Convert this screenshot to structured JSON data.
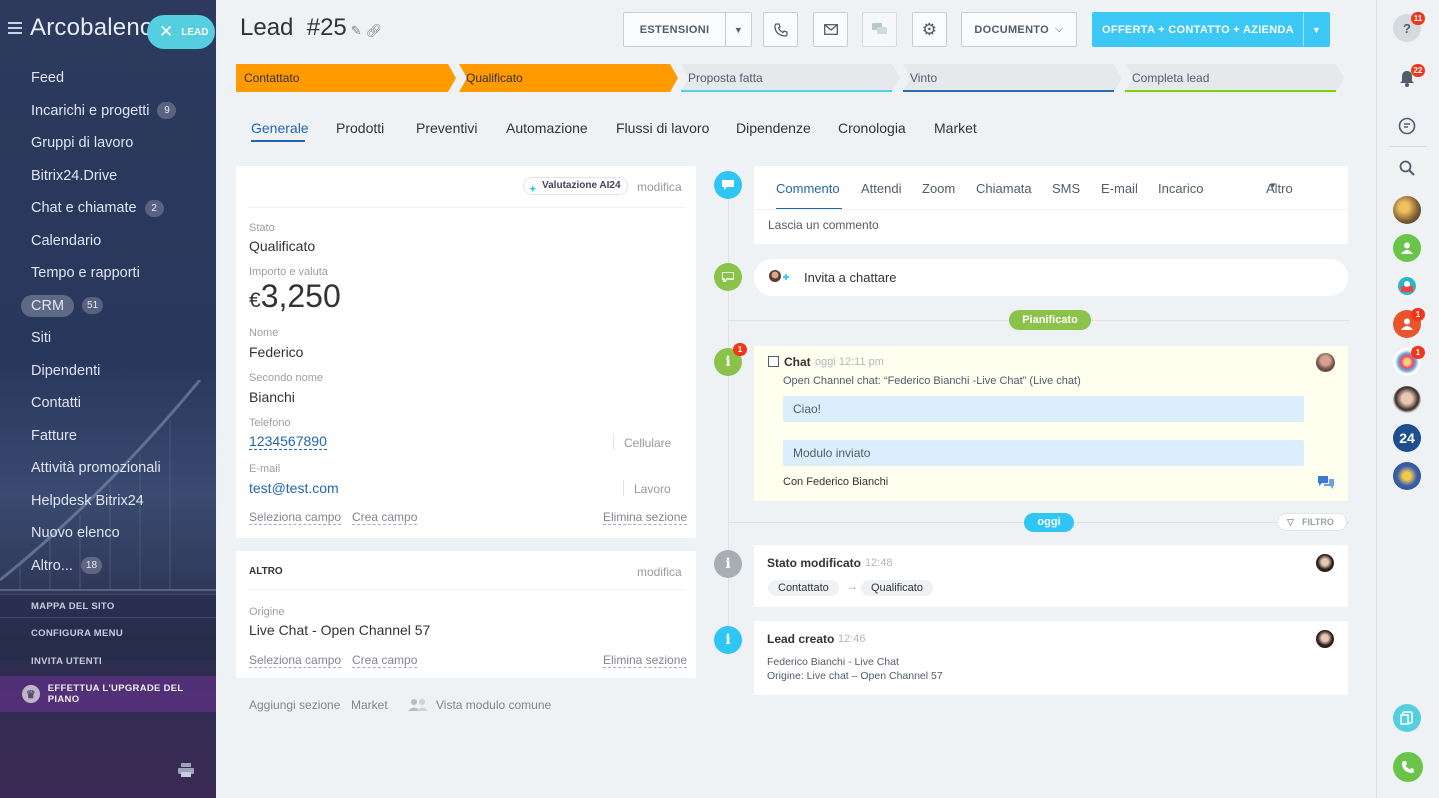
{
  "sidebar": {
    "brand": "Arcobaleno",
    "lead_pill": "LEAD",
    "items": [
      {
        "label": "Feed",
        "count": ""
      },
      {
        "label": "Incarichi e progetti",
        "count": "9"
      },
      {
        "label": "Gruppi di lavoro",
        "count": ""
      },
      {
        "label": "Bitrix24.Drive",
        "count": ""
      },
      {
        "label": "Chat e chiamate",
        "count": "2"
      },
      {
        "label": "Calendario",
        "count": ""
      },
      {
        "label": "Tempo e rapporti",
        "count": ""
      },
      {
        "label": "CRM",
        "count": "51"
      },
      {
        "label": "Siti",
        "count": ""
      },
      {
        "label": "Dipendenti",
        "count": ""
      },
      {
        "label": "Contatti",
        "count": ""
      },
      {
        "label": "Fatture",
        "count": ""
      },
      {
        "label": "Attività promozionali",
        "count": ""
      },
      {
        "label": "Helpdesk Bitrix24",
        "count": ""
      },
      {
        "label": "Nuovo elenco",
        "count": ""
      },
      {
        "label": "Altro...",
        "count": "18"
      }
    ],
    "site_map": "MAPPA DEL SITO",
    "configure_menu": "CONFIGURA MENU",
    "invite_users": "INVITA UTENTI",
    "upgrade": "EFFETTUA L'UPGRADE DEL PIANO"
  },
  "header": {
    "title": "Lead  #25",
    "extensions": "ESTENSIONI",
    "document": "DOCUMENTO",
    "primary": "OFFERTA + CONTATTO + AZIENDA"
  },
  "stages": [
    {
      "label": "Contattato",
      "color": "#ff9a00"
    },
    {
      "label": "Qualificato",
      "color": "#ff9a00"
    },
    {
      "label": "Proposta fatta",
      "color": "#e6e9ec"
    },
    {
      "label": "Vinto",
      "color": "#e6e9ec"
    },
    {
      "label": "Completa lead",
      "color": "#e6e9ec"
    }
  ],
  "tabs": [
    "Generale",
    "Prodotti",
    "Preventivi",
    "Automazione",
    "Flussi di lavoro",
    "Dipendenze",
    "Cronologia",
    "Market"
  ],
  "details": {
    "ai_label": "Valutazione AI24",
    "edit": "modifica",
    "status_label": "Stato",
    "status_value": "Qualificato",
    "amount_label": "Importo e valuta",
    "currency": "€",
    "amount": "3,250",
    "name_label": "Nome",
    "name_value": "Federico",
    "second_name_label": "Secondo nome",
    "second_name_value": "Bianchi",
    "phone_label": "Telefono",
    "phone_value": "1234567890",
    "phone_type": "Cellulare",
    "email_label": "E-mail",
    "email_value": "test@test.com",
    "email_type": "Lavoro",
    "select_field": "Seleziona campo",
    "create_field": "Crea campo",
    "delete_section": "Elimina sezione"
  },
  "other": {
    "title": "ALTRO",
    "edit": "modifica",
    "source_label": "Origine",
    "source_value": "Live Chat - Open Channel 57",
    "select_field": "Seleziona campo",
    "create_field": "Crea campo",
    "delete_section": "Elimina sezione"
  },
  "footer_links": {
    "add_section": "Aggiungi sezione",
    "market": "Market",
    "common_view": "Vista modulo comune"
  },
  "activity_tabs": [
    "Commento",
    "Attendi",
    "Zoom",
    "Chiamata",
    "SMS",
    "E-mail",
    "Incarico"
  ],
  "activity_more": "Altro",
  "comment_placeholder": "Lascia un commento",
  "invite_chat": "Invita a chattare",
  "planned": "Pianificato",
  "chat_item": {
    "title": "Chat",
    "time": "oggi 12:11 pm",
    "subtitle": "Open Channel chat: “Federico Bianchi -Live Chat” (Live chat)",
    "msg1": "Ciao!",
    "msg2": "Modulo inviato",
    "with": "Con Federico Bianchi",
    "badge": "1"
  },
  "today": "oggi",
  "filter": "FILTRO",
  "status_changed": {
    "title": "Stato modificato",
    "time": "12:48",
    "from": "Contattato",
    "arrow": "→",
    "to": "Qualificato"
  },
  "lead_created": {
    "title": "Lead creato",
    "time": "12:46",
    "line1": "Federico Bianchi - Live Chat",
    "line2": "Origine: Live chat – Open Channel 57"
  },
  "right_bar": {
    "help_badge": "11",
    "notif_badge": "22",
    "avatar_badge1": "1",
    "avatar_badge2": "1",
    "b24": "24"
  }
}
